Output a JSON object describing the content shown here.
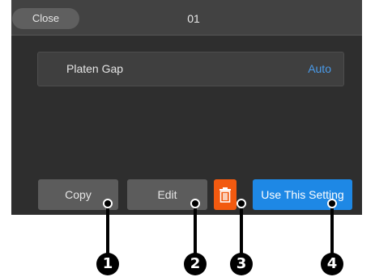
{
  "header": {
    "close_label": "Close",
    "title": "01"
  },
  "setting": {
    "label": "Platen Gap",
    "value": "Auto"
  },
  "buttons": {
    "copy": "Copy",
    "edit": "Edit",
    "delete_icon": "trash-icon",
    "use": "Use This Setting"
  },
  "callouts": [
    "1",
    "2",
    "3",
    "4"
  ],
  "colors": {
    "screen_bg": "#2e2e2e",
    "topbar_bg": "#424242",
    "accent_blue": "#1e88e5",
    "value_blue": "#4a9bea",
    "delete_orange": "#f25a10"
  }
}
